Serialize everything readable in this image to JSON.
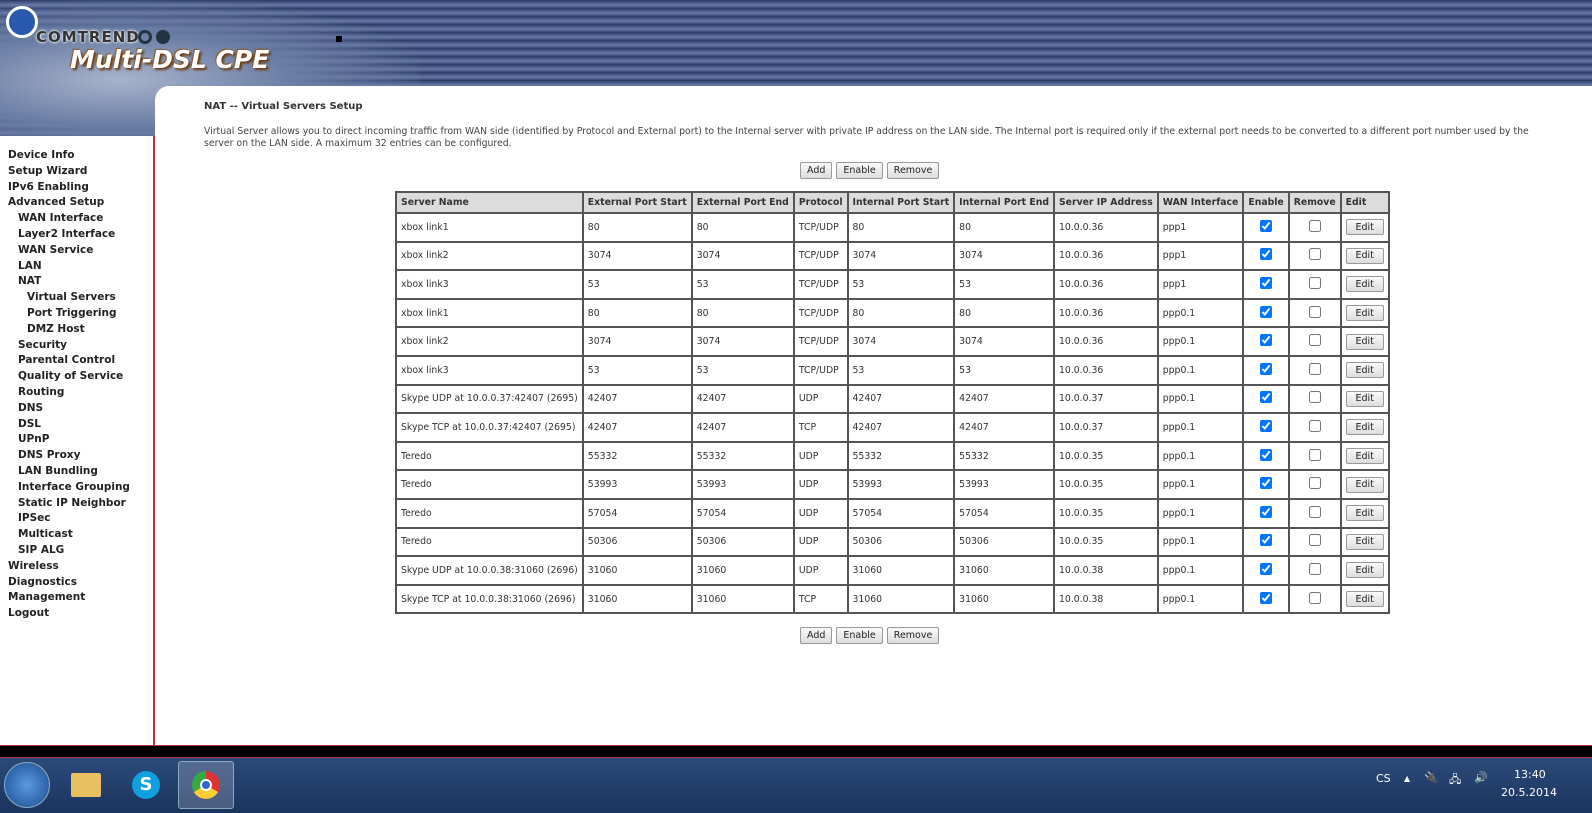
{
  "header": {
    "brand": "COMTREND",
    "product": "Multi-DSL CPE"
  },
  "sidebar": {
    "items": [
      {
        "label": "Device Info",
        "level": 0
      },
      {
        "label": "Setup Wizard",
        "level": 0
      },
      {
        "label": "IPv6 Enabling",
        "level": 0
      },
      {
        "label": "Advanced Setup",
        "level": 0
      },
      {
        "label": "WAN Interface",
        "level": 1
      },
      {
        "label": "Layer2 Interface",
        "level": 1
      },
      {
        "label": "WAN Service",
        "level": 1
      },
      {
        "label": "LAN",
        "level": 1
      },
      {
        "label": "NAT",
        "level": 1
      },
      {
        "label": "Virtual Servers",
        "level": 2
      },
      {
        "label": "Port Triggering",
        "level": 2
      },
      {
        "label": "DMZ Host",
        "level": 2
      },
      {
        "label": "Security",
        "level": 1
      },
      {
        "label": "Parental Control",
        "level": 1
      },
      {
        "label": "Quality of Service",
        "level": 1
      },
      {
        "label": "Routing",
        "level": 1
      },
      {
        "label": "DNS",
        "level": 1
      },
      {
        "label": "DSL",
        "level": 1
      },
      {
        "label": "UPnP",
        "level": 1
      },
      {
        "label": "DNS Proxy",
        "level": 1
      },
      {
        "label": "LAN Bundling",
        "level": 1
      },
      {
        "label": "Interface Grouping",
        "level": 1
      },
      {
        "label": "Static IP Neighbor",
        "level": 1
      },
      {
        "label": "IPSec",
        "level": 1
      },
      {
        "label": "Multicast",
        "level": 1
      },
      {
        "label": "SIP ALG",
        "level": 1
      },
      {
        "label": "Wireless",
        "level": 0
      },
      {
        "label": "Diagnostics",
        "level": 0
      },
      {
        "label": "Management",
        "level": 0
      },
      {
        "label": "Logout",
        "level": 0
      }
    ]
  },
  "main": {
    "title": "NAT -- Virtual Servers Setup",
    "description": "Virtual Server allows you to direct incoming traffic from WAN side (identified by Protocol and External port) to the Internal server with private IP address on the LAN side. The Internal port is required only if the external port needs to be converted to a different port number used by the server on the LAN side. A maximum 32 entries can be configured.",
    "buttons": {
      "add": "Add",
      "enable": "Enable",
      "remove": "Remove"
    },
    "edit_label": "Edit",
    "columns": [
      "Server Name",
      "External Port Start",
      "External Port End",
      "Protocol",
      "Internal Port Start",
      "Internal Port End",
      "Server IP Address",
      "WAN Interface",
      "Enable",
      "Remove",
      "Edit"
    ],
    "rows": [
      [
        "xbox link1",
        "80",
        "80",
        "TCP/UDP",
        "80",
        "80",
        "10.0.0.36",
        "ppp1"
      ],
      [
        "xbox link2",
        "3074",
        "3074",
        "TCP/UDP",
        "3074",
        "3074",
        "10.0.0.36",
        "ppp1"
      ],
      [
        "xbox link3",
        "53",
        "53",
        "TCP/UDP",
        "53",
        "53",
        "10.0.0.36",
        "ppp1"
      ],
      [
        "xbox link1",
        "80",
        "80",
        "TCP/UDP",
        "80",
        "80",
        "10.0.0.36",
        "ppp0.1"
      ],
      [
        "xbox link2",
        "3074",
        "3074",
        "TCP/UDP",
        "3074",
        "3074",
        "10.0.0.36",
        "ppp0.1"
      ],
      [
        "xbox link3",
        "53",
        "53",
        "TCP/UDP",
        "53",
        "53",
        "10.0.0.36",
        "ppp0.1"
      ],
      [
        "Skype UDP at 10.0.0.37:42407 (2695)",
        "42407",
        "42407",
        "UDP",
        "42407",
        "42407",
        "10.0.0.37",
        "ppp0.1"
      ],
      [
        "Skype TCP at 10.0.0.37:42407 (2695)",
        "42407",
        "42407",
        "TCP",
        "42407",
        "42407",
        "10.0.0.37",
        "ppp0.1"
      ],
      [
        "Teredo",
        "55332",
        "55332",
        "UDP",
        "55332",
        "55332",
        "10.0.0.35",
        "ppp0.1"
      ],
      [
        "Teredo",
        "53993",
        "53993",
        "UDP",
        "53993",
        "53993",
        "10.0.0.35",
        "ppp0.1"
      ],
      [
        "Teredo",
        "57054",
        "57054",
        "UDP",
        "57054",
        "57054",
        "10.0.0.35",
        "ppp0.1"
      ],
      [
        "Teredo",
        "50306",
        "50306",
        "UDP",
        "50306",
        "50306",
        "10.0.0.35",
        "ppp0.1"
      ],
      [
        "Skype UDP at 10.0.0.38:31060 (2696)",
        "31060",
        "31060",
        "UDP",
        "31060",
        "31060",
        "10.0.0.38",
        "ppp0.1"
      ],
      [
        "Skype TCP at 10.0.0.38:31060 (2696)",
        "31060",
        "31060",
        "TCP",
        "31060",
        "31060",
        "10.0.0.38",
        "ppp0.1"
      ]
    ],
    "enabled": [
      true,
      true,
      true,
      true,
      true,
      true,
      true,
      true,
      true,
      true,
      true,
      true,
      true,
      true
    ],
    "removed": [
      false,
      false,
      false,
      false,
      false,
      false,
      false,
      false,
      false,
      false,
      false,
      false,
      false,
      false
    ]
  },
  "taskbar": {
    "apps": [
      "windows-explorer",
      "skype",
      "chrome"
    ],
    "language": "CS",
    "time": "13:40",
    "date": "20.5.2014"
  }
}
